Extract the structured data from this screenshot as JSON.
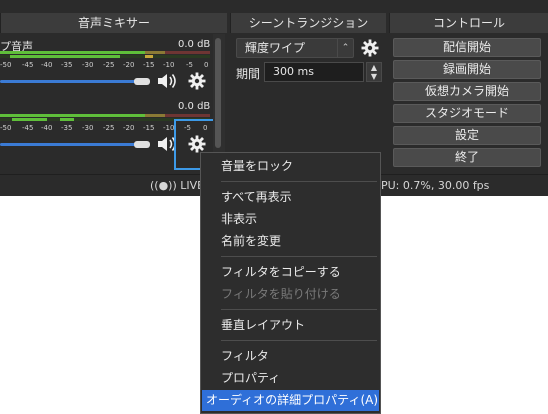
{
  "docks": {
    "mixer_title": "音声ミキサー",
    "transitions_title": "シーントランジション",
    "controls_title": "コントロール"
  },
  "mixer": {
    "channels": [
      {
        "name": "プ音声",
        "db": "0.0 dB"
      },
      {
        "name": "",
        "db": "0.0 dB"
      }
    ],
    "scale": [
      "-50",
      "-45",
      "-40",
      "-35",
      "-30",
      "-25",
      "-20",
      "-15",
      "-10",
      "-5",
      "0"
    ],
    "scale2": [
      "-50",
      "-45",
      "-40",
      "-35",
      "-30",
      "-25",
      "-20",
      "-15",
      "-10",
      "-5",
      "0"
    ]
  },
  "transitions": {
    "selected": "輝度ワイプ",
    "duration_label": "期間",
    "duration_value": "300 ms"
  },
  "controls": {
    "buttons": [
      "配信開始",
      "録画開始",
      "仮想カメラ開始",
      "スタジオモード",
      "設定",
      "終了"
    ]
  },
  "status": {
    "live": "LIVE",
    "cpu": "PU: 0.7%, 30.00 fps"
  },
  "context_menu": {
    "items": [
      {
        "label": "音量をロック"
      },
      {
        "label": "すべて再表示"
      },
      {
        "label": "非表示"
      },
      {
        "label": "名前を変更"
      },
      {
        "label": "フィルタをコピーする"
      },
      {
        "label": "フィルタを貼り付ける"
      },
      {
        "label": "垂直レイアウト"
      },
      {
        "label": "フィルタ"
      },
      {
        "label": "プロパティ"
      },
      {
        "label": "オーディオの詳細プロパティ(A)"
      }
    ]
  },
  "colors": {
    "accent": "#2f6fd8",
    "focus": "#3d9ae8",
    "panel": "#2b2b2b"
  }
}
